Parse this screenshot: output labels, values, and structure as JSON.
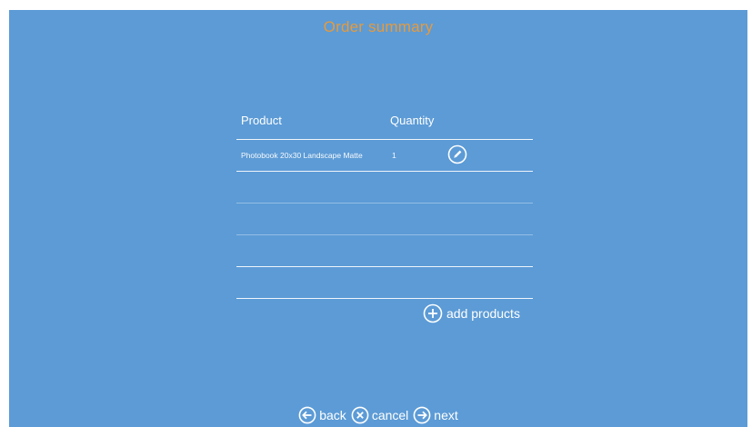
{
  "header": {
    "title": "Order summary"
  },
  "table": {
    "columns": {
      "product": "Product",
      "quantity": "Quantity"
    },
    "rows": [
      {
        "product": "Photobook 20x30 Landscape Matte",
        "quantity": "1"
      }
    ]
  },
  "actions": {
    "add_products": "add products"
  },
  "nav": {
    "back": "back",
    "cancel": "cancel",
    "next": "next"
  },
  "colors": {
    "background": "#5c9bd6",
    "title": "#e69a3c",
    "text": "#ffffff"
  },
  "icons": {
    "edit": "pencil-circle-icon",
    "add": "plus-circle-icon",
    "back": "arrow-left-circle-icon",
    "cancel": "x-circle-icon",
    "next": "arrow-right-circle-icon"
  }
}
